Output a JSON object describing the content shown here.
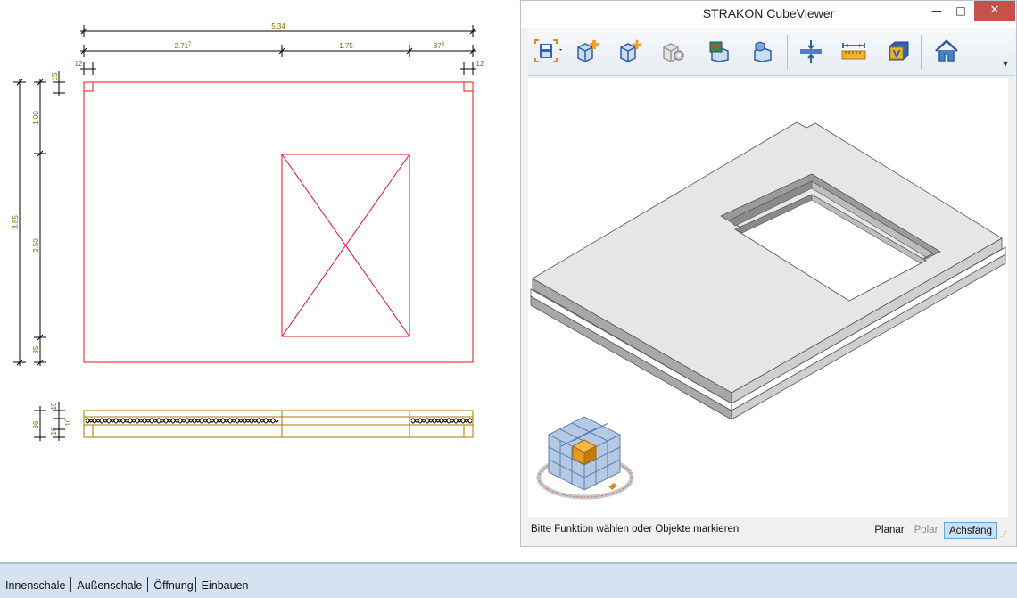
{
  "drawing": {
    "dims": {
      "total_width": "5.34",
      "seg1": "2.71",
      "seg1_sup": "7",
      "seg2": "1.75",
      "seg3": "87",
      "seg3_sup": "3",
      "left_offset": "12",
      "right_offset": "12",
      "total_height": "3.85",
      "h_top": "1.00",
      "h_mid": "2.50",
      "h_bottom": "35",
      "h_top_small": "15",
      "section_total": "36",
      "section_top": "10",
      "section_mid": "16",
      "section_bottom": "10"
    }
  },
  "viewer": {
    "title": "STRAKON CubeViewer",
    "min_label": "—",
    "max_label": "□",
    "close_label": "✕",
    "status_text": "Bitte Funktion wählen oder Objekte markieren",
    "modes": {
      "planar": "Planar",
      "polar": "Polar",
      "achsfang": "Achsfang"
    },
    "toolbar_icons": [
      "save-icon",
      "add-object-icon",
      "move-object-icon",
      "settings-icon",
      "view-image-icon",
      "view-cube-icon",
      "section-icon",
      "measure-icon",
      "volume-icon",
      "home-icon"
    ]
  },
  "tabs": [
    {
      "label": "Innenschale"
    },
    {
      "label": "Außenschale"
    },
    {
      "label": "Öffnung"
    },
    {
      "label": "Einbauen"
    }
  ]
}
